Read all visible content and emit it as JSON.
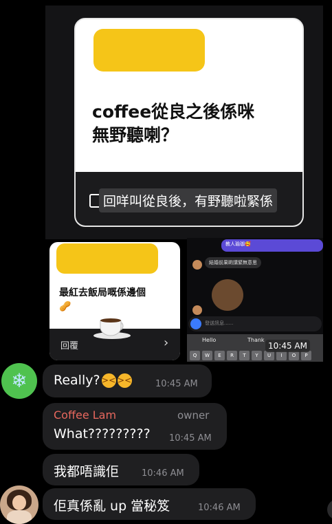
{
  "forwarded_top": {
    "title": "coffee從良之後係咪\n無野聽喇？",
    "caption": "回咩叫從良後，有野聽啦緊係"
  },
  "forwarded_mid": {
    "title": "最紅去飯局嘅係邊個",
    "peanut": "🥜",
    "reply_label": "回覆",
    "chevron": "›"
  },
  "screenshot_panel": {
    "purple_text": "教人瑜珈🥰",
    "grey_text": "結婚前果啲講緊無意思",
    "input_placeholder": "發送訊息......",
    "keyboard_suggestions": [
      "Hello",
      "Thank"
    ],
    "keys": [
      "Q",
      "W",
      "E",
      "R",
      "T",
      "Y",
      "U",
      "I",
      "O",
      "P"
    ],
    "timestamp": "10:45 AM"
  },
  "messages": [
    {
      "text": "Really?",
      "emojis": [
        "😣",
        "😣"
      ],
      "time": "10:45 AM"
    },
    {
      "sender": "Coffee Lam",
      "badge": "owner",
      "text": "What?????????",
      "time": "10:45 AM"
    },
    {
      "text": "我都唔識佢",
      "time": "10:46 AM"
    },
    {
      "text": "佢真係亂 up 當秘笈",
      "time": "10:46 AM"
    }
  ],
  "avatar1_icon": "snowflake-icon",
  "avatar1_glyph": "❄",
  "colors": {
    "background": "#000000",
    "bubble": "#1f1f21",
    "sender_name": "#e8685e",
    "highlight": "#f5c518",
    "avatar_green": "#4fc24f"
  }
}
